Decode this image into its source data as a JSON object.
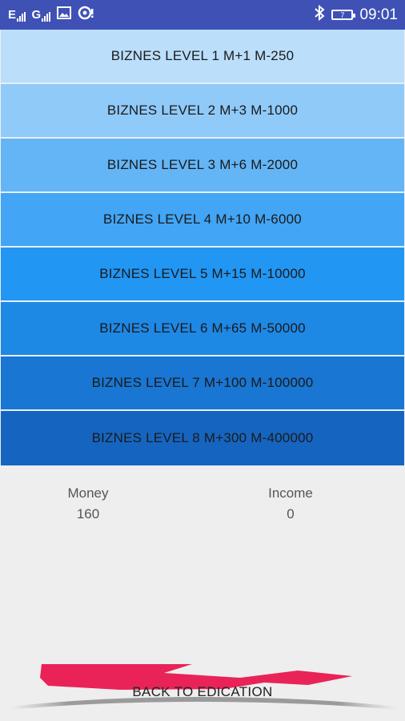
{
  "status_bar": {
    "sim1": "E",
    "sim2": "G",
    "battery_level": "7",
    "time": "09:01",
    "icons": [
      "signal-icon",
      "signal-icon",
      "gallery-icon",
      "chat-icon",
      "bluetooth-icon",
      "battery-icon"
    ]
  },
  "levels": [
    {
      "label": "BIZNES LEVEL 1 M+1 M-250",
      "color": "#bbdefb"
    },
    {
      "label": "BIZNES LEVEL 2 M+3 M-1000",
      "color": "#90caf9"
    },
    {
      "label": "BIZNES LEVEL 3 M+6 M-2000",
      "color": "#64b5f6"
    },
    {
      "label": "BIZNES LEVEL 4 M+10 M-6000",
      "color": "#42a5f5"
    },
    {
      "label": "BIZNES LEVEL 5 M+15 M-10000",
      "color": "#2196f3"
    },
    {
      "label": "BIZNES LEVEL 6 M+65 M-50000",
      "color": "#1e88e5"
    },
    {
      "label": "BIZNES LEVEL 7 M+100 M-100000",
      "color": "#1976d2"
    },
    {
      "label": "BIZNES LEVEL 8 M+300 M-400000",
      "color": "#1565c0"
    }
  ],
  "stats": {
    "money_label": "Money",
    "money_value": "160",
    "income_label": "Income",
    "income_value": "0"
  },
  "back_button": {
    "label": "BACK TO EDICATION",
    "accent_color": "#e8174f"
  }
}
